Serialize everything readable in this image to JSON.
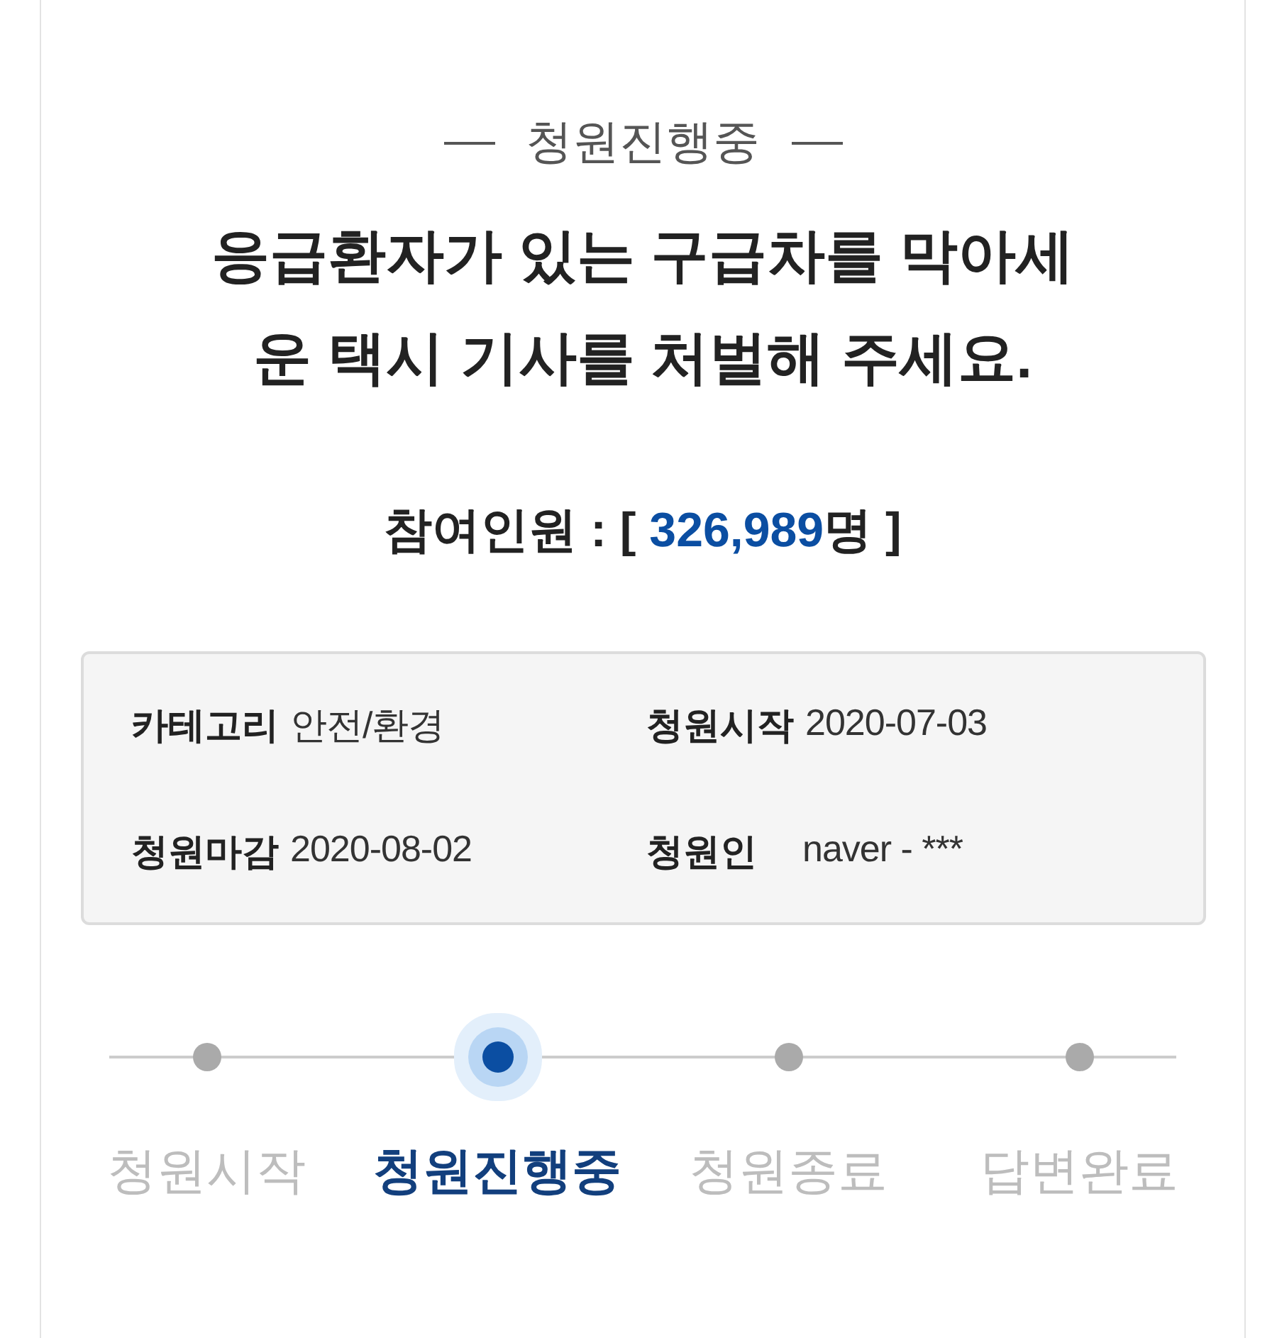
{
  "status_heading": "청원진행중",
  "title_lines": [
    "응급환자가 있는 구급차를 막아세",
    "운 택시 기사를 처벌해 주세요."
  ],
  "participants": {
    "label": "참여인원 :",
    "open": "[",
    "value": "326,989",
    "unit": "명",
    "close": "]"
  },
  "info": [
    {
      "label": "카테고리",
      "value": "안전/환경"
    },
    {
      "label": "청원시작",
      "value": "2020-07-03"
    },
    {
      "label": "청원마감",
      "value": "2020-08-02"
    },
    {
      "label": "청원인",
      "value": "naver - ***"
    }
  ],
  "steps": [
    {
      "label": "청원시작",
      "selected": false
    },
    {
      "label": "청원진행중",
      "selected": true
    },
    {
      "label": "청원종료",
      "selected": false
    },
    {
      "label": "답변완료",
      "selected": false
    }
  ]
}
